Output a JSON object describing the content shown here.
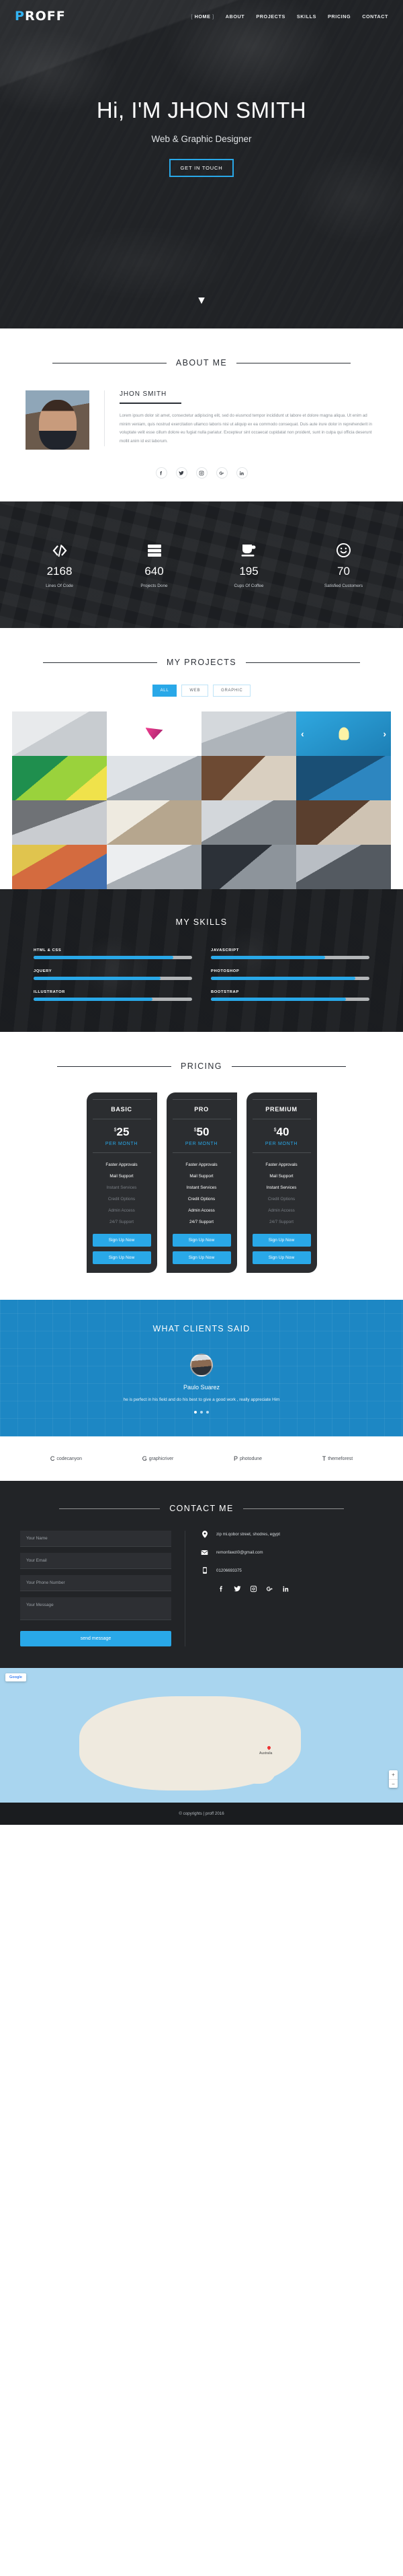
{
  "nav": {
    "logo_p": "P",
    "logo_rest": "ROFF",
    "items": [
      {
        "label": "HOME",
        "active": true
      },
      {
        "label": "ABOUT",
        "active": false
      },
      {
        "label": "PROJECTS",
        "active": false
      },
      {
        "label": "SKILLS",
        "active": false
      },
      {
        "label": "PRICING",
        "active": false
      },
      {
        "label": "CONTACT",
        "active": false
      }
    ]
  },
  "hero": {
    "greeting": "Hi,",
    "name": "I'M JHON SMITH",
    "subtitle": "Web & Graphic Designer",
    "cta": "GET IN TOUCH",
    "scroll_icon": "chevron-down-icon"
  },
  "about": {
    "heading": "ABOUT ME",
    "name": "JHON SMITH",
    "paragraph": "Lorem ipsum dolor sit amet, consectetur adipiscing elit, sed do eiusmod tempor incididunt ut labore et dolore magna aliqua. Ut enim ad minim veniam, quis nostrud exercitation ullamco laboris nisi ut aliquip ex ea commodo consequat. Duis aute irure dolor in reprehenderit in voluptate velit esse cillum dolore eu fugiat nulla pariatur. Excepteur sint occaecat cupidatat non proident, sunt in culpa qui officia deserunt mollit anim id est laborum.",
    "socials": [
      "facebook-icon",
      "twitter-icon",
      "instagram-icon",
      "google-plus-icon",
      "linkedin-icon"
    ]
  },
  "stats": [
    {
      "icon": "code-icon",
      "number": "2168",
      "label": "Lines Of Code"
    },
    {
      "icon": "server-icon",
      "number": "640",
      "label": "Projects Done"
    },
    {
      "icon": "coffee-icon",
      "number": "195",
      "label": "Cups Of Coffee"
    },
    {
      "icon": "smile-icon",
      "number": "70",
      "label": "Satisfied Customers"
    }
  ],
  "projects": {
    "heading": "MY PROJECTS",
    "filters": [
      {
        "label": "ALL",
        "active": true
      },
      {
        "label": "WEB",
        "active": false
      },
      {
        "label": "GRAPHIC",
        "active": false
      }
    ],
    "prev_icon": "chevron-left-icon",
    "next_icon": "chevron-right-icon"
  },
  "skills": {
    "heading": "MY SKILLS",
    "items": [
      {
        "name": "HTML & CSS",
        "percent": 88
      },
      {
        "name": "JAVASCRIPT",
        "percent": 72
      },
      {
        "name": "JQUERY",
        "percent": 80
      },
      {
        "name": "PHOTOSHOP",
        "percent": 91
      },
      {
        "name": "ILLUSTRATOR",
        "percent": 75
      },
      {
        "name": "BOOTSTRAP",
        "percent": 85
      }
    ]
  },
  "pricing": {
    "heading": "PRICING",
    "accent_color": "#29a8e8",
    "plans": [
      {
        "title": "BASIC",
        "currency": "$",
        "amount": "25",
        "period": "PER MONTH",
        "features": [
          {
            "label": "Faster Approvals",
            "enabled": true
          },
          {
            "label": "Mail Support",
            "enabled": true
          },
          {
            "label": "Instant Services",
            "enabled": false
          },
          {
            "label": "Credit Options",
            "enabled": false
          },
          {
            "label": "Admin Access",
            "enabled": false
          },
          {
            "label": "24/7 Support",
            "enabled": false
          }
        ],
        "buttons": [
          "Sign Up Now",
          "Sign Up Now"
        ]
      },
      {
        "title": "PRO",
        "currency": "$",
        "amount": "50",
        "period": "PER MONTH",
        "features": [
          {
            "label": "Faster Approvals",
            "enabled": true
          },
          {
            "label": "Mail Support",
            "enabled": true
          },
          {
            "label": "Instant Services",
            "enabled": true
          },
          {
            "label": "Credit Options",
            "enabled": true
          },
          {
            "label": "Admin Access",
            "enabled": true
          },
          {
            "label": "24/7 Support",
            "enabled": true
          }
        ],
        "buttons": [
          "Sign Up Now",
          "Sign Up Now"
        ]
      },
      {
        "title": "PREMIUM",
        "currency": "$",
        "amount": "40",
        "period": "PER MONTH",
        "features": [
          {
            "label": "Faster Approvals",
            "enabled": true
          },
          {
            "label": "Mail Support",
            "enabled": true
          },
          {
            "label": "Instant Services",
            "enabled": true
          },
          {
            "label": "Credit Options",
            "enabled": false
          },
          {
            "label": "Admin Access",
            "enabled": false
          },
          {
            "label": "24/7 Support",
            "enabled": false
          }
        ],
        "buttons": [
          "Sign Up Now",
          "Sign Up Now"
        ]
      }
    ]
  },
  "testimonial": {
    "heading": "WHAT CLIENTS SAID",
    "author": "Paulo Suarez",
    "quote": "he is perfect in his field and do his best to give a good work , really appreciate Him",
    "dots": 3,
    "active_dot": 0,
    "bg_color": "#1d87c4"
  },
  "clients": [
    {
      "mark": "C",
      "name": "codecanyon"
    },
    {
      "mark": "G",
      "name": "graphicriver"
    },
    {
      "mark": "P",
      "name": "photodune"
    },
    {
      "mark": "T",
      "name": "themeforest"
    }
  ],
  "contact": {
    "heading": "CONTACT ME",
    "fields": [
      {
        "name": "name",
        "placeholder": "Your Name",
        "value": "",
        "type": "text"
      },
      {
        "name": "email",
        "placeholder": "Your Email",
        "value": "",
        "type": "text"
      },
      {
        "name": "phone",
        "placeholder": "Your Phone Number",
        "value": "",
        "type": "text"
      },
      {
        "name": "message",
        "placeholder": "Your Message",
        "value": "",
        "type": "textarea"
      }
    ],
    "submit": "send message",
    "info": [
      {
        "icon": "location-icon",
        "text": "zip mi.qobor street, shodres, egypt"
      },
      {
        "icon": "mail-icon",
        "text": "remonfawzi0@gmail.com"
      },
      {
        "icon": "phone-icon",
        "text": "01206693375"
      }
    ],
    "socials": [
      "facebook-icon",
      "twitter-icon",
      "instagram-icon",
      "google-plus-icon",
      "linkedin-icon"
    ]
  },
  "map": {
    "badge": "Google",
    "pin_label": "Australia",
    "zoom_in": "+",
    "zoom_out": "−"
  },
  "footer": {
    "text": "© copyrights | proff 2016"
  }
}
